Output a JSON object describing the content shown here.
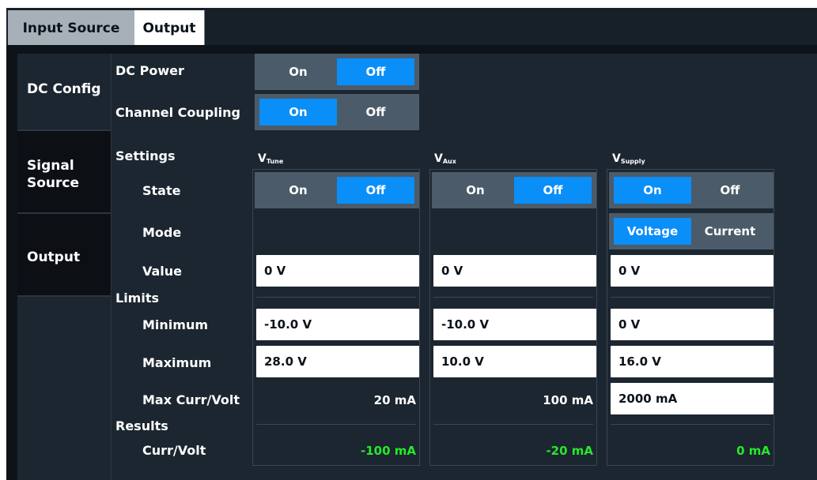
{
  "tabs": [
    {
      "label": "Input Source",
      "active": false
    },
    {
      "label": "Output",
      "active": true
    }
  ],
  "sidenav": [
    {
      "label": "DC Config",
      "selected": true
    },
    {
      "label": "Signal Source",
      "selected": false
    },
    {
      "label": "Output",
      "selected": false
    }
  ],
  "dc_power": {
    "label": "DC Power",
    "on": "On",
    "off": "Off",
    "selected": "Off"
  },
  "channel_coupling": {
    "label": "Channel Coupling",
    "on": "On",
    "off": "Off",
    "selected": "On"
  },
  "labels": {
    "settings": "Settings",
    "state": "State",
    "mode": "Mode",
    "value": "Value",
    "limits": "Limits",
    "minimum": "Minimum",
    "maximum": "Maximum",
    "max_curr_volt": "Max Curr/Volt",
    "results": "Results",
    "curr_volt": "Curr/Volt"
  },
  "columns": [
    {
      "head": "V",
      "sub": "Tune",
      "state": {
        "on": "On",
        "off": "Off",
        "selected": "Off"
      },
      "value": "0 V",
      "minimum": "-10.0 V",
      "maximum": "28.0 V",
      "max_curr_volt": "20 mA",
      "result": "-100 mA"
    },
    {
      "head": "V",
      "sub": "Aux",
      "state": {
        "on": "On",
        "off": "Off",
        "selected": "Off"
      },
      "value": "0 V",
      "minimum": "-10.0 V",
      "maximum": "10.0 V",
      "max_curr_volt": "100 mA",
      "result": "-20 mA"
    },
    {
      "head": "V",
      "sub": "Supply",
      "state": {
        "on": "On",
        "off": "Off",
        "selected": "On"
      },
      "mode": {
        "voltage": "Voltage",
        "current": "Current",
        "selected": "Voltage"
      },
      "value": "0 V",
      "minimum": "0 V",
      "maximum": "16.0 V",
      "max_curr_volt": "2000 mA",
      "result": "0 mA"
    }
  ],
  "colors": {
    "selected": "#0a8ef8",
    "result_text": "#27e82a",
    "panel": "#1c2630"
  }
}
